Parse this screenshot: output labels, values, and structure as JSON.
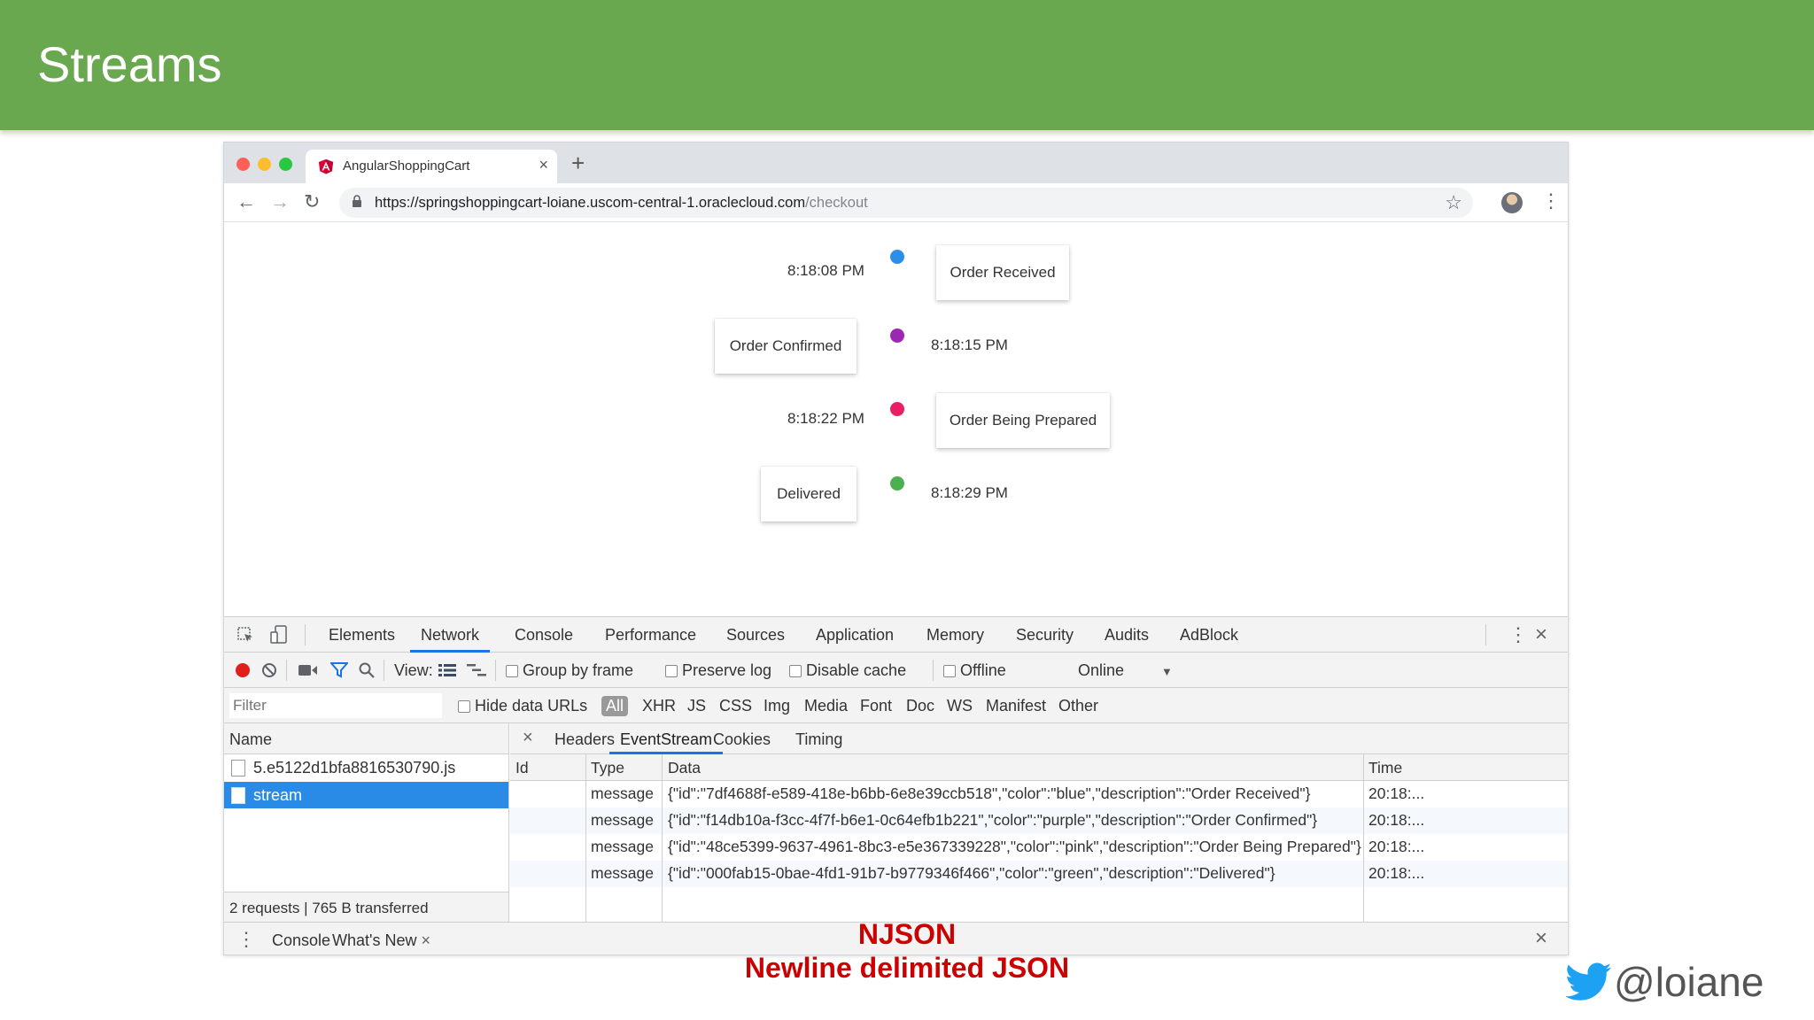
{
  "slide": {
    "title": "Streams"
  },
  "browser": {
    "tab_title": "AngularShoppingCart",
    "url_host": "https://springshoppingcart-loiane.uscom-central-1.oraclecloud.com",
    "url_path": "/checkout"
  },
  "timeline": [
    {
      "time": "8:18:08 PM",
      "description": "Order Received",
      "color": "#2b8ee8"
    },
    {
      "time": "8:18:15 PM",
      "description": "Order Confirmed",
      "color": "#9c27b0"
    },
    {
      "time": "8:18:22 PM",
      "description": "Order Being Prepared",
      "color": "#e91e63"
    },
    {
      "time": "8:18:29 PM",
      "description": "Delivered",
      "color": "#4caf50"
    }
  ],
  "devtools": {
    "tabs": [
      "Elements",
      "Network",
      "Console",
      "Performance",
      "Sources",
      "Application",
      "Memory",
      "Security",
      "Audits",
      "AdBlock"
    ],
    "active_tab": "Network",
    "toolbar": {
      "view_label": "View:",
      "group_by_frame": "Group by frame",
      "preserve_log": "Preserve log",
      "disable_cache": "Disable cache",
      "offline": "Offline",
      "throttle": "Online"
    },
    "filter": {
      "placeholder": "Filter",
      "hide_data_urls": "Hide data URLs",
      "types": [
        "All",
        "XHR",
        "JS",
        "CSS",
        "Img",
        "Media",
        "Font",
        "Doc",
        "WS",
        "Manifest",
        "Other"
      ],
      "active_type": "All"
    },
    "name_header": "Name",
    "requests": [
      "5.e5122d1bfa8816530790.js",
      "stream"
    ],
    "selected_request": "stream",
    "summary": "2 requests | 765 B transferred",
    "detail_tabs": [
      "Headers",
      "EventStream",
      "Cookies",
      "Timing"
    ],
    "active_detail_tab": "EventStream",
    "columns": {
      "id": "Id",
      "type": "Type",
      "data": "Data",
      "time": "Time"
    },
    "events": [
      {
        "id": "",
        "type": "message",
        "data": "{\"id\":\"7df4688f-e589-418e-b6bb-6e8e39ccb518\",\"color\":\"blue\",\"description\":\"Order Received\"}",
        "time": "20:18:..."
      },
      {
        "id": "",
        "type": "message",
        "data": "{\"id\":\"f14db10a-f3cc-4f7f-b6e1-0c64efb1b221\",\"color\":\"purple\",\"description\":\"Order Confirmed\"}",
        "time": "20:18:..."
      },
      {
        "id": "",
        "type": "message",
        "data": "{\"id\":\"48ce5399-9637-4961-8bc3-e5e367339228\",\"color\":\"pink\",\"description\":\"Order Being Prepared\"}",
        "time": "20:18:..."
      },
      {
        "id": "",
        "type": "message",
        "data": "{\"id\":\"000fab15-0bae-4fd1-91b7-b9779346f466\",\"color\":\"green\",\"description\":\"Delivered\"}",
        "time": "20:18:..."
      }
    ],
    "drawer_tabs": [
      "Console",
      "What's New"
    ],
    "active_drawer_tab": "What's New"
  },
  "caption": {
    "line1": "NJSON",
    "line2": "Newline delimited JSON"
  },
  "social": {
    "handle": "@loiane",
    "icon": "twitter-bird"
  }
}
